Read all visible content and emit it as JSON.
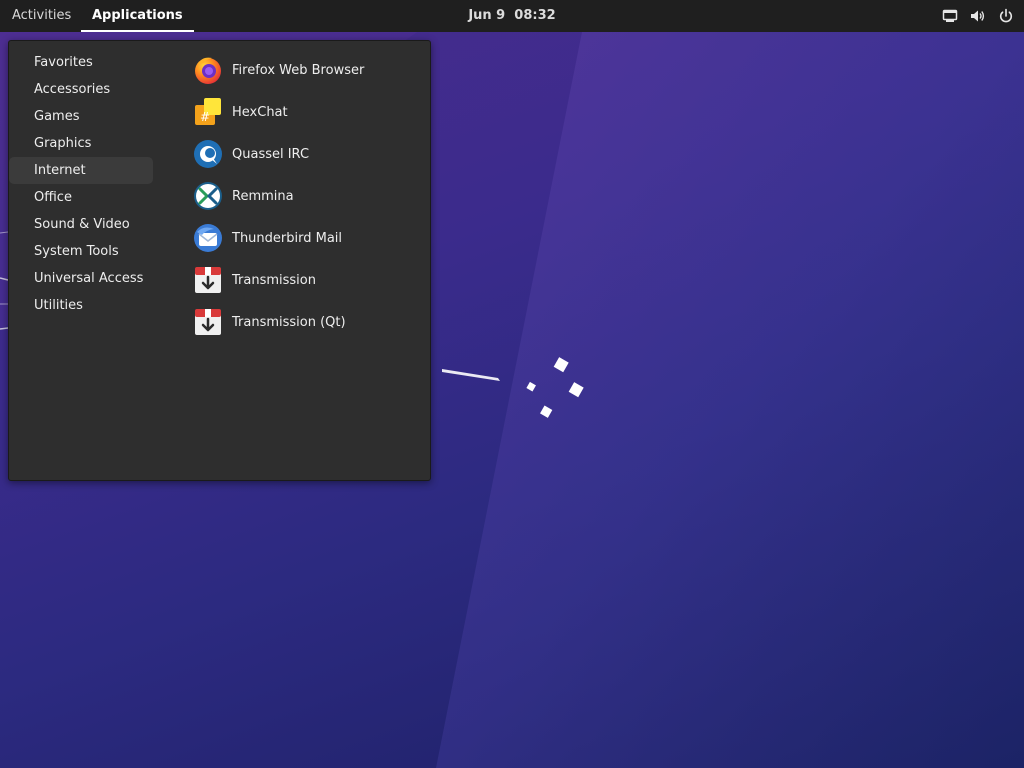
{
  "topbar": {
    "activities": "Activities",
    "applications": "Applications",
    "date": "Jun 9",
    "time": "08:32",
    "tray_icons": [
      "network-icon",
      "volume-icon",
      "power-icon"
    ]
  },
  "menu": {
    "categories": [
      {
        "label": "Favorites"
      },
      {
        "label": "Accessories"
      },
      {
        "label": "Games"
      },
      {
        "label": "Graphics"
      },
      {
        "label": "Internet",
        "active": true
      },
      {
        "label": "Office"
      },
      {
        "label": "Sound & Video"
      },
      {
        "label": "System Tools"
      },
      {
        "label": "Universal Access"
      },
      {
        "label": "Utilities"
      }
    ],
    "apps": [
      {
        "label": "Firefox Web Browser",
        "icon": "firefox-icon"
      },
      {
        "label": "HexChat",
        "icon": "hexchat-icon"
      },
      {
        "label": "Quassel IRC",
        "icon": "quassel-icon"
      },
      {
        "label": "Remmina",
        "icon": "remmina-icon"
      },
      {
        "label": "Thunderbird Mail",
        "icon": "thunderbird-icon"
      },
      {
        "label": "Transmission",
        "icon": "transmission-icon"
      },
      {
        "label": "Transmission (Qt)",
        "icon": "transmission-qt-icon"
      }
    ]
  },
  "colors": {
    "topbar_bg": "#1f1f1f",
    "menu_bg": "#2e2e2e",
    "active_category_bg": "#3b3b3b",
    "wallpaper_primary": "#3b2b8c",
    "wallpaper_dark": "#1c1f63"
  }
}
